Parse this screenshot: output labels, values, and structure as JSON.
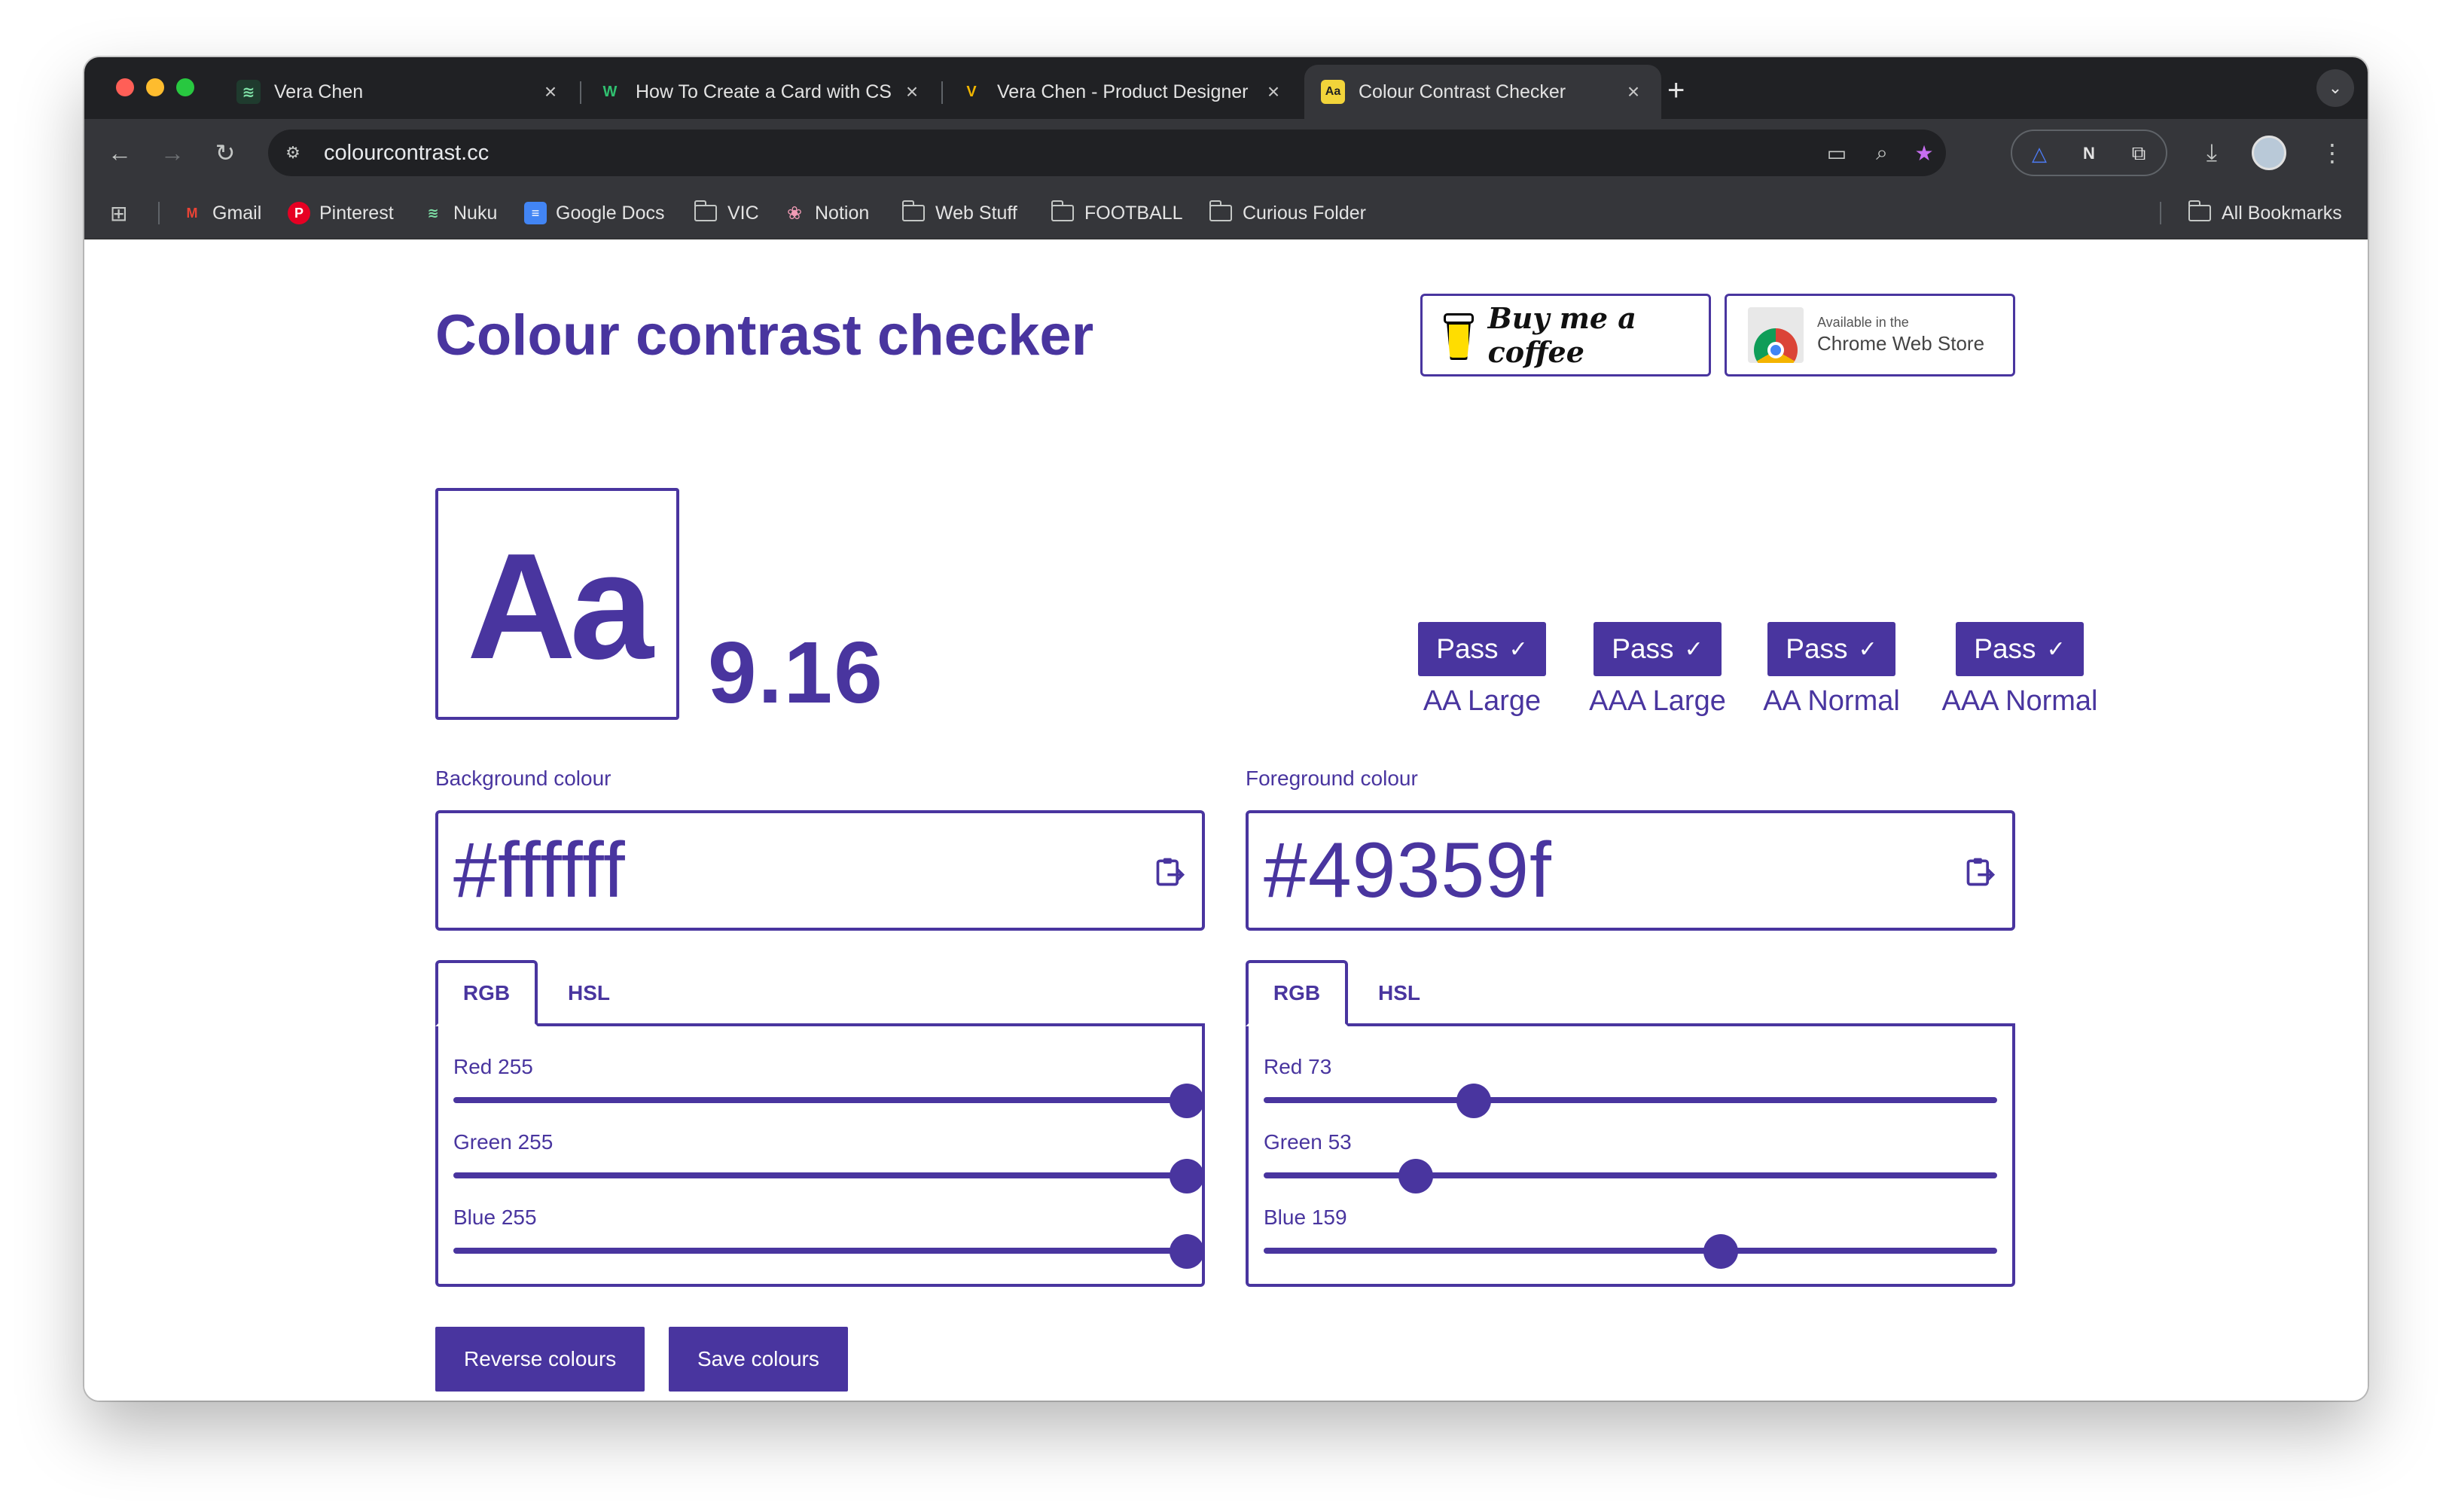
{
  "browser": {
    "tabs": [
      {
        "title": "Vera Chen",
        "favicon": "vc-logo-icon",
        "active": false
      },
      {
        "title": "How To Create a Card with CS",
        "favicon": "w-logo-icon",
        "active": false
      },
      {
        "title": "Vera Chen - Product Designer",
        "favicon": "v-logo-icon",
        "active": false
      },
      {
        "title": "Colour Contrast Checker",
        "favicon": "aa-icon",
        "active": true
      }
    ],
    "new_tab_label": "+",
    "url": "colourcontrast.cc",
    "bookmarks": [
      {
        "label": "Gmail",
        "icon": "gmail-icon"
      },
      {
        "label": "Pinterest",
        "icon": "pinterest-icon"
      },
      {
        "label": "Nuku",
        "icon": "nuku-icon"
      },
      {
        "label": "Google Docs",
        "icon": "docs-icon"
      },
      {
        "label": "VIC",
        "icon": "folder-icon"
      },
      {
        "label": "Notion",
        "icon": "brain-icon"
      },
      {
        "label": "Web Stuff",
        "icon": "folder-icon"
      },
      {
        "label": "FOOTBALL",
        "icon": "folder-icon"
      },
      {
        "label": "Curious Folder",
        "icon": "folder-icon"
      },
      {
        "label": "All Bookmarks",
        "icon": "folder-icon"
      }
    ]
  },
  "page": {
    "title": "Colour contrast checker",
    "bmc_label": "Buy me a coffee",
    "cws_small": "Available in the",
    "cws_big": "Chrome Web Store",
    "sample_text": "Aa",
    "ratio": "9.16",
    "results": [
      {
        "status": "Pass",
        "label": "AA Large"
      },
      {
        "status": "Pass",
        "label": "AAA Large"
      },
      {
        "status": "Pass",
        "label": "AA Normal"
      },
      {
        "status": "Pass",
        "label": "AAA Normal"
      }
    ],
    "background": {
      "label": "Background colour",
      "hex": "#ffffff",
      "tabs": [
        "RGB",
        "HSL"
      ],
      "selected_tab": "RGB",
      "sliders": [
        {
          "label": "Red 255",
          "value": 255,
          "max": 255
        },
        {
          "label": "Green 255",
          "value": 255,
          "max": 255
        },
        {
          "label": "Blue 255",
          "value": 255,
          "max": 255
        }
      ]
    },
    "foreground": {
      "label": "Foreground colour",
      "hex": "#49359f",
      "tabs": [
        "RGB",
        "HSL"
      ],
      "selected_tab": "RGB",
      "sliders": [
        {
          "label": "Red 73",
          "value": 73,
          "max": 255
        },
        {
          "label": "Green 53",
          "value": 53,
          "max": 255
        },
        {
          "label": "Blue 159",
          "value": 159,
          "max": 255
        }
      ]
    },
    "buttons": {
      "reverse": "Reverse colours",
      "save": "Save colours"
    },
    "colors": {
      "accent": "#49359f",
      "chrome_dark": "#202124",
      "chrome_toolbar": "#35363a"
    }
  }
}
